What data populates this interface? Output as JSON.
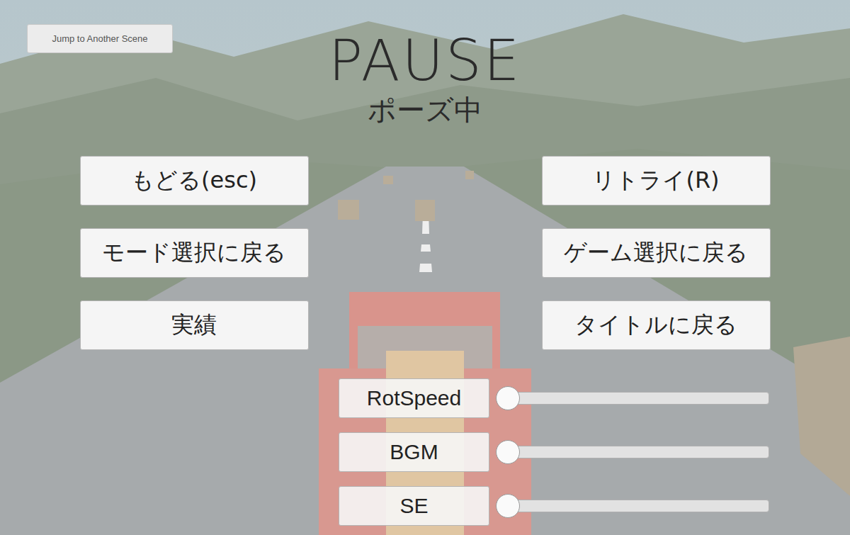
{
  "scene_button": "Jump to Another Scene",
  "title": "PAUSE",
  "subtitle": "ポーズ中",
  "menu": [
    {
      "label": "もどる(esc)"
    },
    {
      "label": "リトライ(R)"
    },
    {
      "label": "モード選択に戻る"
    },
    {
      "label": "ゲーム選択に戻る"
    },
    {
      "label": "実績"
    },
    {
      "label": "タイトルに戻る"
    }
  ],
  "sliders": [
    {
      "label": "RotSpeed",
      "level": 0
    },
    {
      "label": "BGM",
      "level": 0
    },
    {
      "label": "SE",
      "level": 0
    }
  ]
}
